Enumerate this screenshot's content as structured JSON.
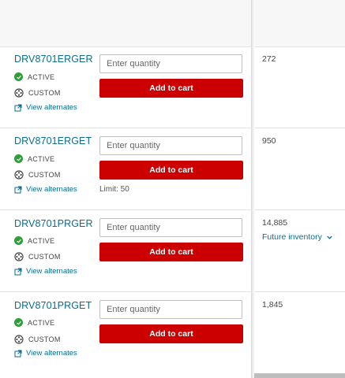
{
  "rows": [
    {
      "part_number": "DRV8701ERGER",
      "status": "ACTIVE",
      "type": "CUSTOM",
      "alternates_link": "View alternates",
      "quantity_placeholder": "Enter quantity",
      "add_to_cart": "Add to cart",
      "limit": "",
      "inventory": "272",
      "future_inventory": ""
    },
    {
      "part_number": "DRV8701ERGET",
      "status": "ACTIVE",
      "type": "CUSTOM",
      "alternates_link": "View alternates",
      "quantity_placeholder": "Enter quantity",
      "add_to_cart": "Add to cart",
      "limit": "Limit: 50",
      "inventory": "950",
      "future_inventory": ""
    },
    {
      "part_number": "DRV8701PRGER",
      "status": "ACTIVE",
      "type": "CUSTOM",
      "alternates_link": "View alternates",
      "quantity_placeholder": "Enter quantity",
      "add_to_cart": "Add to cart",
      "limit": "",
      "inventory": "14,885",
      "future_inventory": "Future inventory"
    },
    {
      "part_number": "DRV8701PRGET",
      "status": "ACTIVE",
      "type": "CUSTOM",
      "alternates_link": "View alternates",
      "quantity_placeholder": "Enter quantity",
      "add_to_cart": "Add to cart",
      "limit": "",
      "inventory": "1,845",
      "future_inventory": ""
    }
  ],
  "colors": {
    "accent_link": "#0a6f8e",
    "cart_button": "#cc0000",
    "active_check": "#2e9e3a"
  },
  "icons": {
    "status": "check-circle-icon",
    "custom": "film-reel-icon",
    "alternates": "external-link-icon",
    "future": "chevron-down-icon"
  }
}
